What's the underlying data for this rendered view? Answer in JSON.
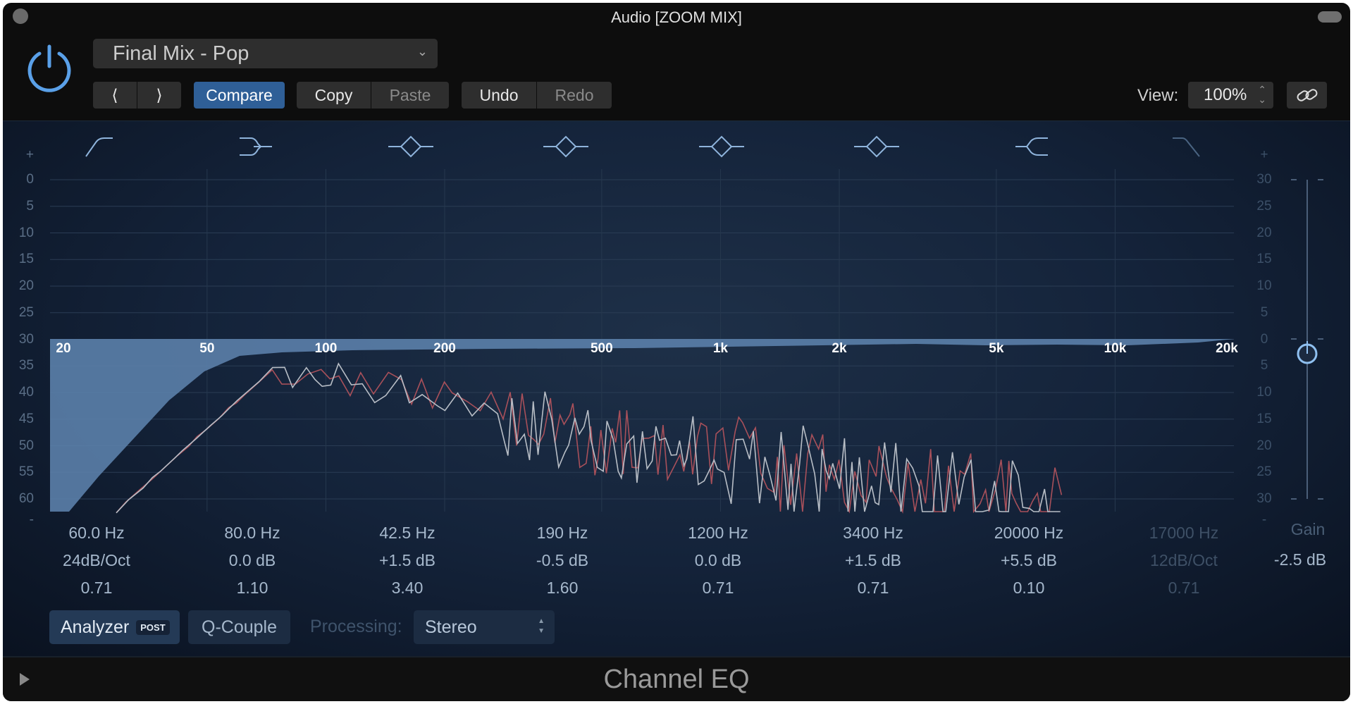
{
  "window": {
    "title": "Audio [ZOOM MIX]"
  },
  "header": {
    "power_icon": "power-icon",
    "preset": "Final Mix - Pop",
    "prev_icon": "chevron-left-icon",
    "next_icon": "chevron-right-icon",
    "compare": "Compare",
    "copy": "Copy",
    "paste": "Paste",
    "undo": "Undo",
    "redo": "Redo",
    "view_label": "View:",
    "view_value": "100%",
    "link_icon": "link-icon"
  },
  "colors": {
    "accent": "#2f5f97",
    "power": "#5aa0e8",
    "eq_fill": "#5b80aa",
    "analyzer_grey": "#b8bec6",
    "analyzer_red": "#a8505a"
  },
  "graph": {
    "left_scale": [
      "+",
      "0",
      "5",
      "10",
      "15",
      "20",
      "25",
      "30",
      "35",
      "40",
      "45",
      "50",
      "55",
      "60",
      "-"
    ],
    "right_scale": [
      "+",
      "30",
      "25",
      "20",
      "15",
      "10",
      "5",
      "0",
      "5",
      "10",
      "15",
      "20",
      "25",
      "30",
      "-"
    ],
    "freq_labels": [
      "20",
      "50",
      "100",
      "200",
      "500",
      "1k",
      "2k",
      "5k",
      "10k",
      "20k"
    ],
    "band_icons": [
      "low-cut-icon",
      "low-shelf-icon",
      "bell-icon",
      "bell-icon",
      "bell-icon",
      "bell-icon",
      "high-shelf-icon",
      "high-cut-icon"
    ]
  },
  "bands": [
    {
      "freq": "60.0 Hz",
      "gain": "24dB/Oct",
      "q": "0.71",
      "enabled": true
    },
    {
      "freq": "80.0 Hz",
      "gain": "0.0 dB",
      "q": "1.10",
      "enabled": true
    },
    {
      "freq": "42.5 Hz",
      "gain": "+1.5 dB",
      "q": "3.40",
      "enabled": true
    },
    {
      "freq": "190 Hz",
      "gain": "-0.5 dB",
      "q": "1.60",
      "enabled": true
    },
    {
      "freq": "1200 Hz",
      "gain": "0.0 dB",
      "q": "0.71",
      "enabled": true
    },
    {
      "freq": "3400 Hz",
      "gain": "+1.5 dB",
      "q": "0.71",
      "enabled": true
    },
    {
      "freq": "20000 Hz",
      "gain": "+5.5 dB",
      "q": "0.10",
      "enabled": true
    },
    {
      "freq": "17000 Hz",
      "gain": "12dB/Oct",
      "q": "0.71",
      "enabled": false
    }
  ],
  "gain": {
    "label": "Gain",
    "value": "-2.5 dB"
  },
  "controls": {
    "analyzer": "Analyzer",
    "post": "POST",
    "qcouple": "Q-Couple",
    "processing_label": "Processing:",
    "processing_value": "Stereo"
  },
  "footer": {
    "name": "Channel EQ",
    "disclosure_icon": "play-triangle-icon"
  }
}
